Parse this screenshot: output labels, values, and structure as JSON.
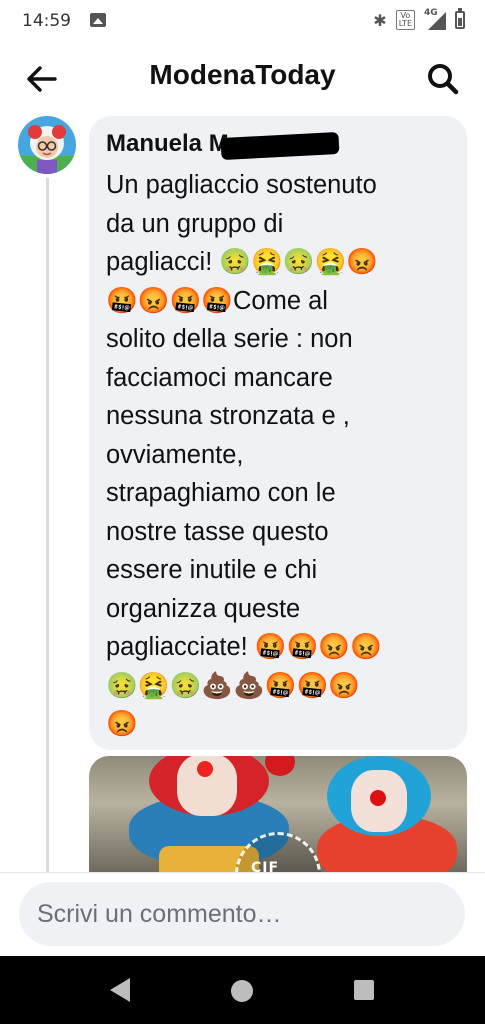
{
  "status_bar": {
    "time": "14:59",
    "network_label": "4G",
    "volte_label": "Vo\nLTE",
    "icons": [
      "gallery-icon",
      "bluetooth-icon",
      "volte-icon",
      "signal-icon",
      "battery-icon"
    ]
  },
  "app_bar": {
    "title": "ModenaToday",
    "back_icon": "arrow-left-icon",
    "search_icon": "search-icon"
  },
  "comment": {
    "author_visible": "Manuela M",
    "text": "Un pagliaccio sostenuto\nda un gruppo di\npagliacci! 🤢🤮🤢🤮😡\n🤬😡🤬🤬Come al\nsolito della serie : non\nfacciamoci mancare\nnessuna stronzata e ,\novviamente,\nstrapaghiamo con le\nnostre tasse questo\nessere inutile e chi\norganizza queste\npagliacciate! 🤬🤬😡😡\n🤢🤮🤢💩💩🤬🤬😡\n😡"
  },
  "photo_preview": {
    "overlay_text": "CIF"
  },
  "composer": {
    "placeholder": "Scrivi un commento…"
  },
  "nav_bar": {
    "icons": [
      "nav-back-icon",
      "nav-home-icon",
      "nav-recents-icon"
    ]
  },
  "colors": {
    "bubble": "#eff1f4",
    "thread_line": "#d9dbe0",
    "navbar": "#000000"
  }
}
